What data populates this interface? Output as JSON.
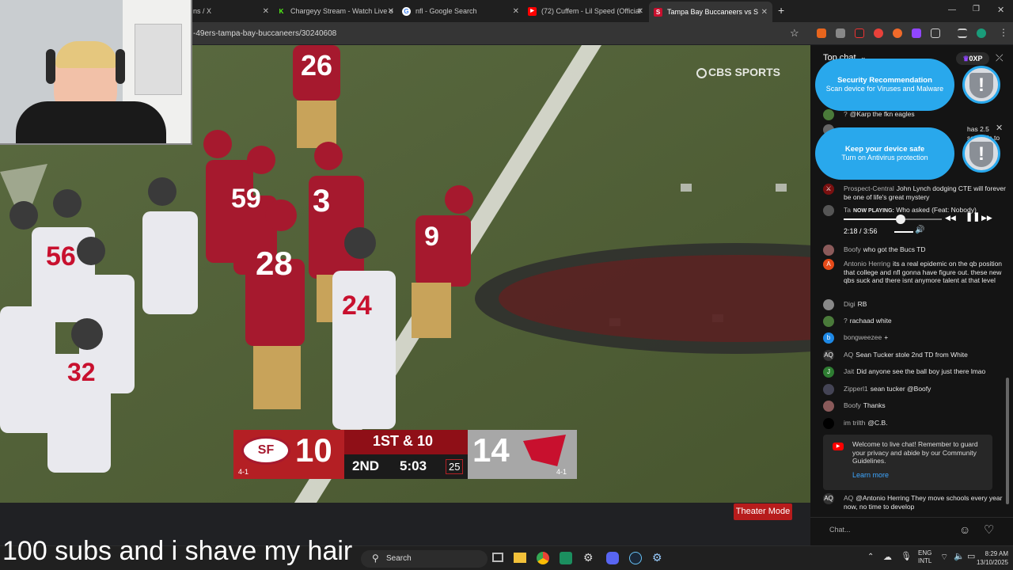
{
  "browser": {
    "tabs": [
      {
        "label": "ns / X"
      },
      {
        "label": "Chargeyy Stream - Watch Live o"
      },
      {
        "label": "nfl - Google Search"
      },
      {
        "label": "(72) Cuffem - Lil Speed (Official"
      },
      {
        "label": "Tampa Bay Buccaneers vs S"
      }
    ],
    "new_tab": "+",
    "url": "-49ers-tampa-bay-buccaneers/30240608"
  },
  "video": {
    "network": "CBS SPORTS",
    "scoreboard": {
      "home_score": "10",
      "home_record": "4-1",
      "down": "1ST & 10",
      "quarter": "2ND",
      "clock": "5:03",
      "play_clock": "25",
      "away_score": "14",
      "away_record": "4-1"
    },
    "jerseys": [
      "26",
      "59",
      "3",
      "28",
      "9",
      "56",
      "24",
      "32"
    ],
    "theater_mode": "Theater Mode"
  },
  "overlay": {
    "caption": "100 subs and i shave my hair"
  },
  "chat": {
    "header": "Top chat",
    "xp": "0XP",
    "messages": [
      {
        "user": "?",
        "text": "@Karp the fkn eagles"
      },
      {
        "user": "",
        "text": "has 2.5 seconds to"
      },
      {
        "user": "Prospect-Central",
        "text": "John Lynch dodging CTE will forever be one of life's great mystery"
      },
      {
        "user": "Boofy",
        "text": "who got the Bucs TD"
      },
      {
        "user": "Antonio Herring",
        "text": "its a real epidemic on the qb position that college and nfl gonna have figure out. these new qbs suck and there isnt anymore talent at that level"
      },
      {
        "user": "Digi",
        "text": "RB"
      },
      {
        "user": "?",
        "text": "rachaad white"
      },
      {
        "user": "bongweezee",
        "text": "+"
      },
      {
        "user": "AQ",
        "text": "Sean Tucker stole 2nd TD from White"
      },
      {
        "user": "Jait",
        "text": "Did anyone see the ball boy just there lmao"
      },
      {
        "user": "Zipperl1",
        "text": "sean tucker @Boofy"
      },
      {
        "user": "Boofy",
        "text": "Thanks"
      },
      {
        "user": "im trilth",
        "text": "@C.B."
      },
      {
        "user": "AQ",
        "text": "@Antonio Herring They move schools every year now, no time to develop"
      }
    ],
    "player": {
      "user": "Ta",
      "now_playing": "NOW PLAYING:",
      "song": "Who asked (Feat: Nobody)",
      "time": "2:18 / 3:56",
      "progress": 0.58
    },
    "notice": "Welcome to live chat! Remember to guard your privacy and abide by our Community Guidelines.",
    "learn_more": "Learn more",
    "input_placeholder": "Chat..."
  },
  "popups": [
    {
      "title": "Security Recommendation",
      "text": "Scan device for Viruses and Malware"
    },
    {
      "title": "Keep your device safe",
      "text": "Turn on Antivirus protection"
    }
  ],
  "taskbar": {
    "search": "Search",
    "lang": "ENG",
    "lang2": "INTL",
    "time": "8:29 AM",
    "date": "13/10/2025"
  }
}
